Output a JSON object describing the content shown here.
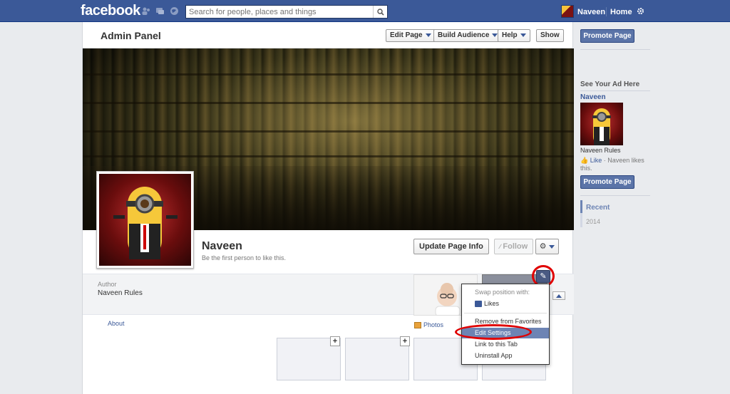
{
  "topbar": {
    "logo": "facebook",
    "search_placeholder": "Search for people, places and things",
    "user_name": "Naveen",
    "home_label": "Home"
  },
  "admin": {
    "title": "Admin Panel",
    "edit_page": "Edit Page",
    "build_audience": "Build Audience",
    "help": "Help",
    "show": "Show"
  },
  "profile": {
    "name": "Naveen",
    "like_prompt": "Be the first person to like this.",
    "update_info": "Update Page Info",
    "follow": "Follow"
  },
  "info": {
    "author_label": "Author",
    "author_value": "Naveen Rules",
    "about": "About",
    "photos": "Photos"
  },
  "menu": {
    "header": "Swap position with:",
    "likes": "Likes",
    "items": [
      "Remove from Favorites",
      "Edit Settings",
      "Link to this Tab",
      "Uninstall App"
    ],
    "selected": "Edit Settings"
  },
  "rail": {
    "promote": "Promote Page",
    "see_ad": "See Your Ad Here",
    "ad_name": "Naveen",
    "ad_text": "Naveen Rules",
    "ad_like": "Like",
    "ad_like_rest": " · Naveen likes this.",
    "recent": "Recent",
    "year": "2014"
  },
  "colors": {
    "brand": "#3b5998",
    "annotation": "#e00000",
    "menu_selected": "#6d84b4"
  }
}
